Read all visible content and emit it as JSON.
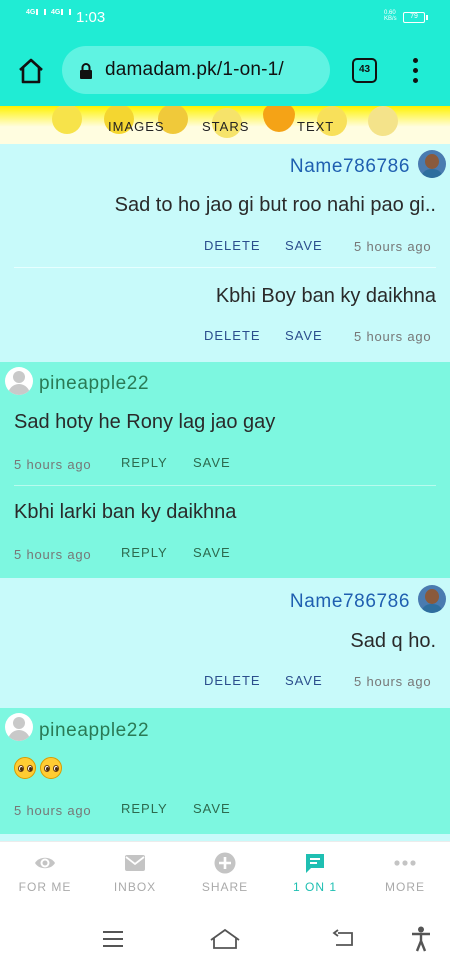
{
  "status_bar": {
    "time": "1:03",
    "signal1": "4G",
    "signal2": "4G",
    "net_speed_top": "0.60",
    "net_speed_bottom": "KB/s",
    "battery": "79"
  },
  "browser": {
    "url": "damadam.pk/1-on-1/",
    "tab_count": "43"
  },
  "nav_strip": {
    "items": [
      "IMAGES",
      "STARS",
      "TEXT"
    ]
  },
  "feed": [
    {
      "side": "mine",
      "username": "Name786786",
      "messages": [
        {
          "text": "Sad to ho jao gi but roo nahi pao gi..",
          "actions": [
            "DELETE",
            "SAVE"
          ],
          "time": "5 hours ago"
        },
        {
          "text": "Kbhi Boy ban ky daikhna",
          "actions": [
            "DELETE",
            "SAVE"
          ],
          "time": "5 hours ago"
        }
      ]
    },
    {
      "side": "theirs",
      "username": "pineapple22",
      "messages": [
        {
          "text": "Sad hoty he Rony lag jao gay",
          "actions": [
            "REPLY",
            "SAVE"
          ],
          "time": "5 hours ago"
        },
        {
          "text": "Kbhi larki ban ky daikhna",
          "actions": [
            "REPLY",
            "SAVE"
          ],
          "time": "5 hours ago"
        }
      ]
    },
    {
      "side": "mine",
      "username": "Name786786",
      "messages": [
        {
          "text": "Sad q ho.",
          "actions": [
            "DELETE",
            "SAVE"
          ],
          "time": "5 hours ago"
        }
      ]
    },
    {
      "side": "theirs",
      "username": "pineapple22",
      "messages": [
        {
          "text": "🥺🥺",
          "actions": [
            "REPLY",
            "SAVE"
          ],
          "time": "5 hours ago"
        }
      ]
    }
  ],
  "bottom_nav": [
    {
      "label": "FOR ME",
      "icon": "eye-icon"
    },
    {
      "label": "INBOX",
      "icon": "envelope-icon"
    },
    {
      "label": "SHARE",
      "icon": "plus-circle-icon"
    },
    {
      "label": "1 ON 1",
      "icon": "chat-icon",
      "active": true
    },
    {
      "label": "MORE",
      "icon": "dots-icon"
    }
  ],
  "colors": {
    "header": "#20ecd4",
    "mine_bg": "#c8fafa",
    "theirs_bg": "#7df7e0",
    "active": "#1fbfb2"
  }
}
